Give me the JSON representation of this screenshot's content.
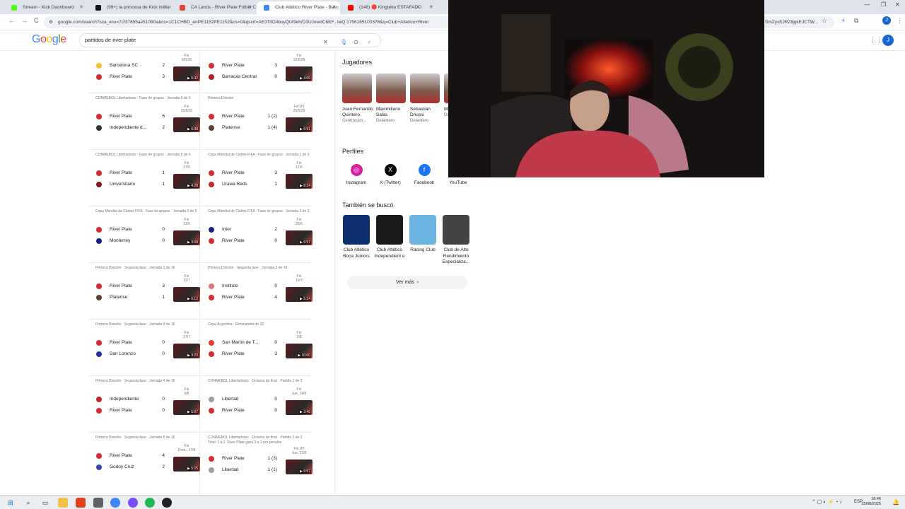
{
  "tabs": [
    {
      "title": "Stream - Kick Dashboard",
      "color": "#53fc18"
    },
    {
      "title": "(99+) la princesa de Kick iniciar",
      "color": "#111111"
    },
    {
      "title": "CA Lanús - River Plate Fútbol C",
      "color": "#e94235"
    },
    {
      "title": "Club Atlético River Plate - Busc",
      "color": "#4285f4",
      "active": true
    },
    {
      "title": "(148) 🔴 Kingteka ESTAFADO",
      "color": "#ff0000"
    }
  ],
  "toolbar": {
    "url": "google.com/search?sca_esv=7cf37855ae51090a&cs=1C1CHBD_enPE1152PE1152&cs=0&qsxrf=AE3TifO4buyQtX9eh/D3UJowdC6KF...lwQ:1756165103378&q=Club+Atletico+River",
    "url_tail": "SmZyvEJRZlljqkEJCTW...",
    "back": "←",
    "forward": "→",
    "reload": "C"
  },
  "google": {
    "logo": "Google",
    "query": "partidos de river plate"
  },
  "matches": [
    {
      "id": "m1",
      "head": "",
      "t1": "Barcelona SC",
      "s1": "2",
      "t2": "River Plate",
      "s2": "3",
      "status": "Fin\n8/5/25",
      "dur": "5:32",
      "c1": "#f2c230",
      "c2": "#d32f2f"
    },
    {
      "id": "m2",
      "head": "",
      "t1": "River Plate",
      "s1": "3",
      "t2": "Barracas Central",
      "s2": "0",
      "status": "Fin\n12/5/25",
      "dur": "4:09",
      "c1": "#d32f2f",
      "c2": "#b71c1c"
    },
    {
      "id": "m3",
      "head": "CONMEBOL Libertadores · Fase de grupos · Jornada 5 de 6",
      "t1": "River Plate",
      "s1": "6",
      "t2": "Independiente d...",
      "s2": "2",
      "status": "Fin\n15/5/25",
      "dur": "6:08",
      "c1": "#d32f2f",
      "c2": "#333333"
    },
    {
      "id": "m4",
      "head": "Primera División",
      "t1": "River Plate",
      "s1": "1 (2)",
      "t2": "Platense",
      "s2": "1 (4)",
      "status": "Fin (P)\n20/5/25",
      "dur": "5:51",
      "c1": "#d32f2f",
      "c2": "#5d4037"
    },
    {
      "id": "m5",
      "head": "CONMEBOL Libertadores · Fase de grupos · Jornada 6 de 6",
      "t1": "River Plate",
      "s1": "1",
      "t2": "Universitario",
      "s2": "1",
      "status": "Fin\n27/5",
      "dur": "4:28",
      "c1": "#d32f2f",
      "c2": "#7b1f1f"
    },
    {
      "id": "m6",
      "head": "Copa Mundial de Clubes FIFA · Fase de grupos · Jornada 1 de 3",
      "t1": "River Plate",
      "s1": "3",
      "t2": "Urawa Reds",
      "s2": "1",
      "status": "Fin\n17/6",
      "dur": "8:24",
      "c1": "#d32f2f",
      "c2": "#c62828"
    },
    {
      "id": "m7",
      "head": "Copa Mundial de Clubes FIFA · Fase de grupos · Jornada 2 de 3",
      "t1": "River Plate",
      "s1": "0",
      "t2": "Monterrey",
      "s2": "0",
      "status": "Fin\n21/6",
      "dur": "3:00",
      "c1": "#d32f2f",
      "c2": "#1a237e"
    },
    {
      "id": "m8",
      "head": "Copa Mundial de Clubes FIFA · Fase de grupos · Jornada 3 de 3",
      "t1": "Inter",
      "s1": "2",
      "t2": "River Plate",
      "s2": "0",
      "status": "Fin\n25/6",
      "dur": "6:57",
      "c1": "#1a237e",
      "c2": "#d32f2f"
    },
    {
      "id": "m9",
      "head": "Primera División · Segunda fase · Jornada 1 de 16",
      "t1": "River Plate",
      "s1": "3",
      "t2": "Platense",
      "s2": "1",
      "status": "Fin\n13/7",
      "dur": "6:12",
      "c1": "#d32f2f",
      "c2": "#5d4037"
    },
    {
      "id": "m10",
      "head": "Primera División · Segunda fase · Jornada 2 de 16",
      "t1": "Instituto",
      "s1": "0",
      "t2": "River Plate",
      "s2": "4",
      "status": "Fin\n19/7",
      "dur": "5:24",
      "c1": "#e57373",
      "c2": "#d32f2f"
    },
    {
      "id": "m11",
      "head": "Primera División · Segunda fase · Jornada 3 de 16",
      "t1": "River Plate",
      "s1": "0",
      "t2": "San Lorenzo",
      "s2": "0",
      "status": "Fin\n27/7",
      "dur": "3:23",
      "c1": "#d32f2f",
      "c2": "#283593"
    },
    {
      "id": "m12",
      "head": "Copa Argentina · Eliminatoria de 32",
      "t1": "San Martín de T...",
      "s1": "0",
      "t2": "River Plate",
      "s2": "3",
      "status": "Fin\n2/8",
      "dur": "10:00",
      "c1": "#e53935",
      "c2": "#d32f2f"
    },
    {
      "id": "m13",
      "head": "Primera División · Segunda fase · Jornada 4 de 16",
      "t1": "Independiente",
      "s1": "0",
      "t2": "River Plate",
      "s2": "0",
      "status": "Fin\n9/8",
      "dur": "5:07",
      "c1": "#c62828",
      "c2": "#d32f2f"
    },
    {
      "id": "m14",
      "head": "CONMEBOL Libertadores · Octavos de final · Partido 1 de 2",
      "t1": "Libertad",
      "s1": "0",
      "t2": "River Plate",
      "s2": "0",
      "status": "Fin\nJue, 14/8",
      "dur": "3:49",
      "c1": "#9e9e9e",
      "c2": "#d32f2f"
    },
    {
      "id": "m15",
      "head": "Primera División · Segunda fase · Jornada 5 de 16",
      "t1": "River Plate",
      "s1": "4",
      "t2": "Godoy Cruz",
      "s2": "2",
      "status": "Fin\nDom., 17/8",
      "dur": "5:25",
      "c1": "#d32f2f",
      "c2": "#3949ab"
    },
    {
      "id": "m16",
      "head": "CONMEBOL Libertadores · Octavos de final · Partido 2 de 2\nTotal: 1 a 1. River Plate gana 3 a 1 por penales",
      "t1": "River Plate",
      "s1": "1 (3)",
      "t2": "Libertad",
      "s2": "1 (1)",
      "status": "Fin (P)\nJue, 21/8",
      "dur": "6:57",
      "c1": "#d32f2f",
      "c2": "#9e9e9e"
    }
  ],
  "side": {
    "players_title": "Jugadores",
    "players": [
      {
        "name": "Juan Fernando Quintero",
        "role": "Centrocam..."
      },
      {
        "name": "Maximiliano Salas",
        "role": "Delantero"
      },
      {
        "name": "Sebastián Driussi",
        "role": "Delantero"
      },
      {
        "name": "Mi...",
        "role": "De..."
      }
    ],
    "profiles_title": "Perfiles",
    "profiles": [
      {
        "name": "Instagram",
        "glyph": "◎",
        "color": "#d6249f"
      },
      {
        "name": "X (Twitter)",
        "glyph": "X",
        "color": "#000000"
      },
      {
        "name": "Facebook",
        "glyph": "f",
        "color": "#1877f2"
      },
      {
        "name": "YouTube",
        "glyph": "",
        "color": "#ffffff"
      }
    ],
    "also_title": "También se buscó",
    "also": [
      {
        "name": "Club Atlético Boca Juniors",
        "color": "#0d2f6e"
      },
      {
        "name": "Club Atlético Independient e",
        "color": "#1b1b1b"
      },
      {
        "name": "Racing Club",
        "color": "#6cb4e4"
      },
      {
        "name": "Club de Alto Rendimiento Especializa...",
        "color": "#444444"
      }
    ],
    "more": "Ver más"
  },
  "taskbar": {
    "time": "18:46",
    "date": "25/08/2025",
    "lang": "ESP"
  }
}
